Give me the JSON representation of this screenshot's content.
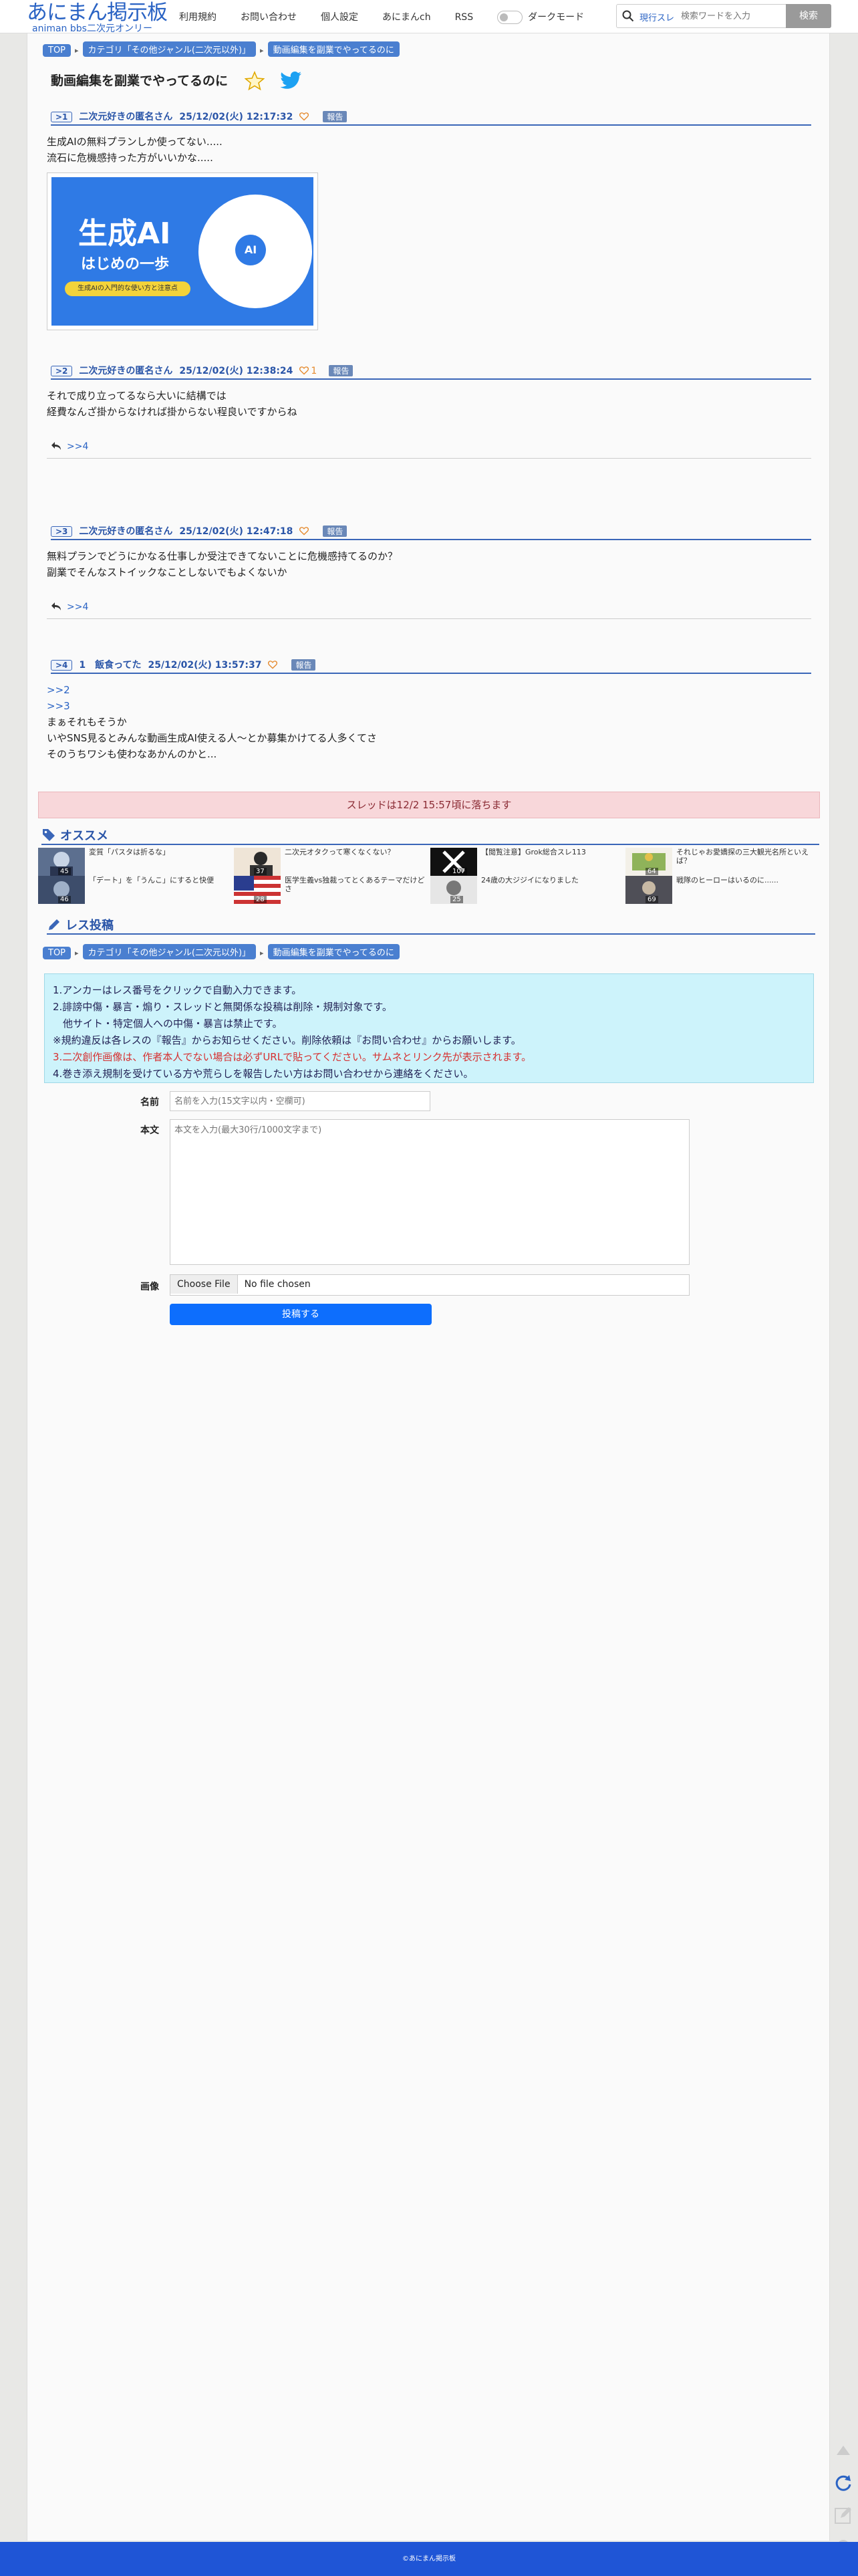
{
  "header": {
    "logo_main": "あにまん掲示板",
    "logo_sub": "animan bbs二次元オンリー",
    "nav": [
      "利用規約",
      "お問い合わせ",
      "個人設定",
      "あにまんch",
      "RSS"
    ],
    "dark_mode_label": "ダークモード",
    "search_label": "現行スレ",
    "search_placeholder": "検索ワードを入力",
    "search_button": "検索"
  },
  "breadcrumb": [
    "TOP",
    "カテゴリ「その他ジャンル(二次元以外)」",
    "動画編集を副業でやってるのに"
  ],
  "thread_title": "動画編集を副業でやってるのに",
  "posts": [
    {
      "num": ">1",
      "name": "二次元好きの匿名さん",
      "date": "25/12/02(火) 12:17:32",
      "likes": "",
      "report": "報告",
      "lines": [
        "生成AIの無料プランしか使ってない.....",
        "流石に危機感持った方がいいかな....."
      ],
      "image": {
        "title": "生成AI",
        "subtitle": "はじめの一歩",
        "tag": "生成AIの入門的な使い方と注意点",
        "badge": "AI"
      }
    },
    {
      "num": ">2",
      "name": "二次元好きの匿名さん",
      "date": "25/12/02(火) 12:38:24",
      "likes": "1",
      "report": "報告",
      "lines": [
        "それで成り立ってるなら大いに結構では",
        "経費なんざ掛からなければ掛からない程良いですからね"
      ],
      "reply": ">>4"
    },
    {
      "num": ">3",
      "name": "二次元好きの匿名さん",
      "date": "25/12/02(火) 12:47:18",
      "likes": "",
      "report": "報告",
      "lines": [
        "無料プランでどうにかなる仕事しか受注できてないことに危機感持てるのか？",
        "副業でそんなストイックなことしないでもよくないか"
      ],
      "reply": ">>4"
    },
    {
      "num": ">4",
      "name": "1　飯食ってた",
      "date": "25/12/02(火) 13:57:37",
      "likes": "",
      "report": "報告",
      "anchors": [
        ">>2",
        ">>3"
      ],
      "lines": [
        "まぁそれもそうか",
        "いやSNS見るとみんな動画生成AI使える人〜とか募集かけてる人多くてさ",
        "そのうちワシも使わなあかんのかと..."
      ]
    }
  ],
  "deadline": "スレッドは12/2 15:57頃に落ちます",
  "recommend": {
    "heading": "オススメ",
    "items": [
      {
        "title": "変質「パスタは折るな」",
        "count": "45"
      },
      {
        "title": "二次元オタクって寒くなくない？",
        "count": "37"
      },
      {
        "title": "【閲覧注意】Grok総合スレ113",
        "count": "107"
      },
      {
        "title": "それじゃお愛嬌探の三大観光名所といえば？",
        "count": "64"
      },
      {
        "title": "「デート」を「うんこ」にすると快便",
        "count": "46"
      },
      {
        "title": "医学生義vs独裁ってとくあるテーマだけどさ",
        "count": "28"
      },
      {
        "title": "24歳の大ジジイになりました",
        "count": "25"
      },
      {
        "title": "戦隊のヒーローはいるのに......",
        "count": "69"
      }
    ]
  },
  "reply_form": {
    "heading": "レス投稿",
    "rules": [
      "1.アンカーはレス番号をクリックで自動入力できます。",
      "2.誹謗中傷・暴言・煽り・スレッドと無関係な投稿は削除・規制対象です。",
      "　他サイト・特定個人への中傷・暴言は禁止です。",
      "※規約違反は各レスの『報告』からお知らせください。削除依頼は『お問い合わせ』からお願いします。",
      "3.二次創作画像は、作者本人でない場合は必ずURLで貼ってください。サムネとリンク先が表示されます。",
      "4.巻き添え規制を受けている方や荒らしを報告したい方はお問い合わせから連絡をください。"
    ],
    "name_label": "名前",
    "name_placeholder": "名前を入力(15文字以内・空欄可)",
    "body_label": "本文",
    "body_placeholder": "本文を入力(最大30行/1000文字まで)",
    "image_label": "画像",
    "choose_file": "Choose File",
    "no_file": "No file chosen",
    "submit": "投稿する"
  },
  "footer": "©あにまん掲示板",
  "colors": {
    "accent": "#2a63c4",
    "footer": "#1f55d6",
    "submit": "#0d6efd",
    "deadline_bg": "#f8d7da",
    "rules_bg": "#cdf3fb"
  }
}
